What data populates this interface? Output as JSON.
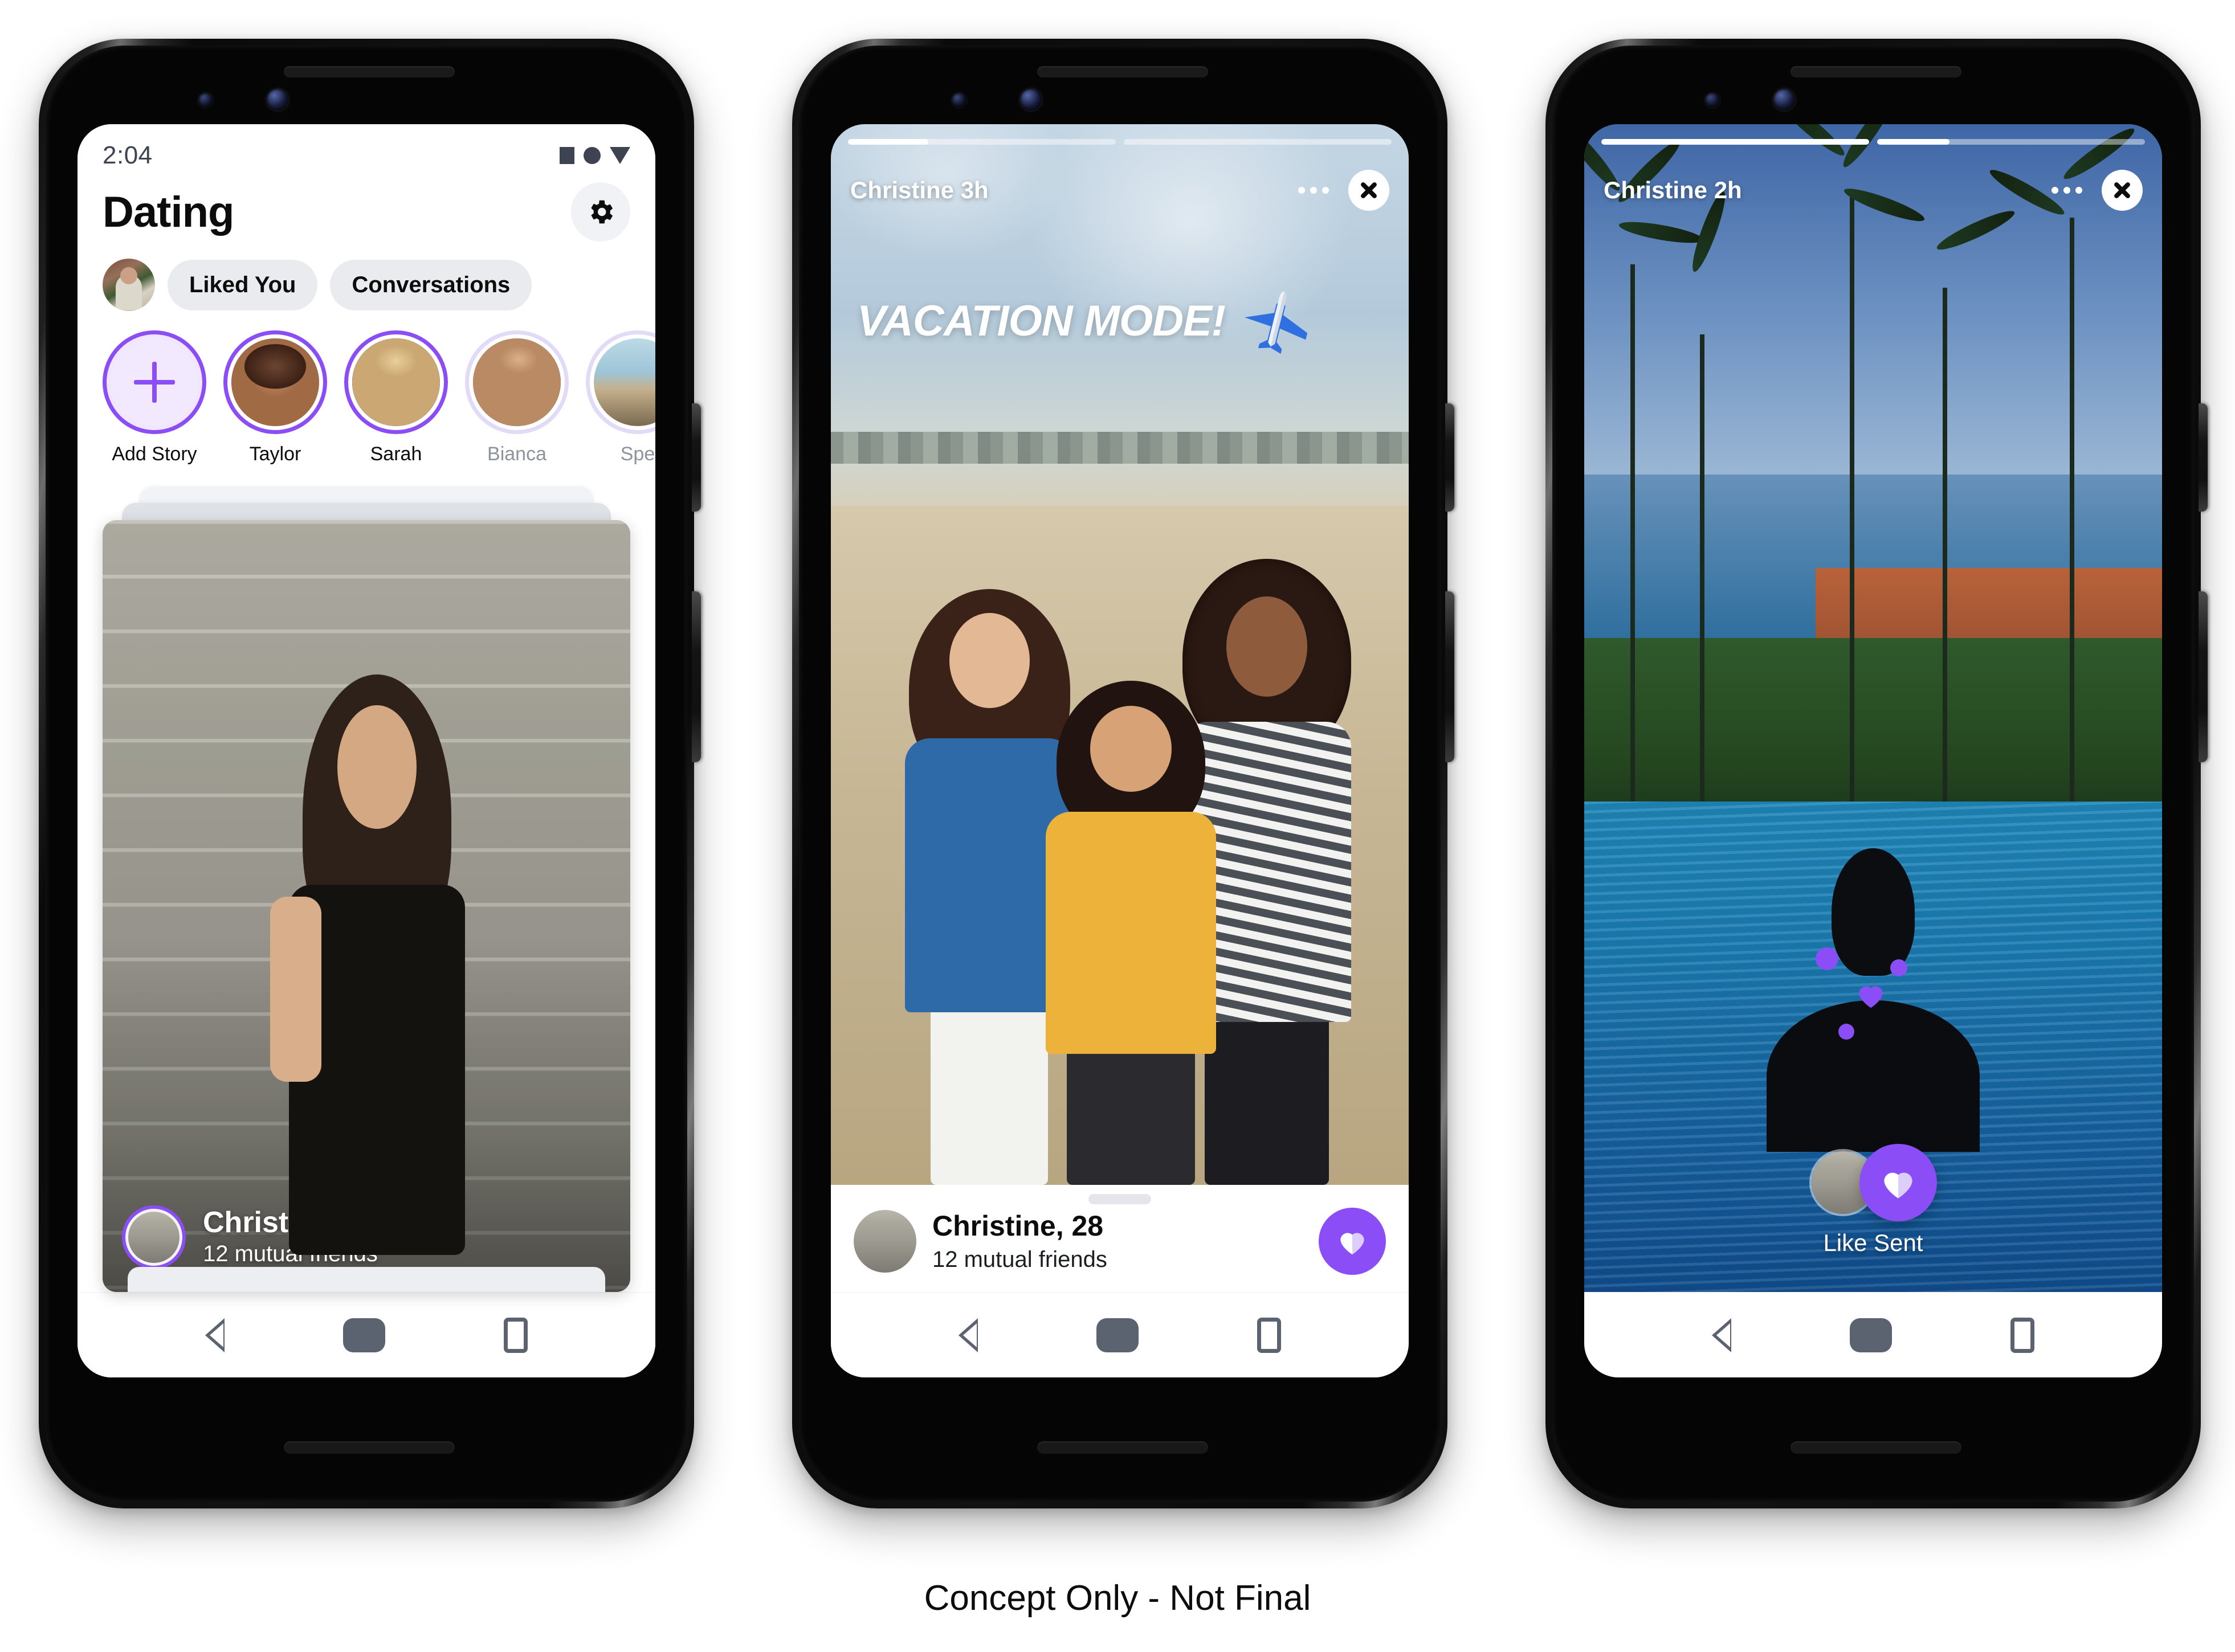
{
  "caption": "Concept Only - Not Final",
  "colors": {
    "accent_purple": "#8B4DF5",
    "pill_bg": "#E9EBEE",
    "status_icon": "#3D4350",
    "nav_icon": "#5B6270",
    "seen_ring": "#E2DBF7"
  },
  "phone1": {
    "status": {
      "time": "2:04",
      "icons": [
        "square-icon",
        "circle-icon",
        "triangle-down-icon"
      ]
    },
    "header": {
      "title": "Dating",
      "settings_icon": "gear-icon"
    },
    "pills": {
      "avatar": "me-avatar",
      "items": [
        "Liked You",
        "Conversations"
      ]
    },
    "stories": [
      {
        "label": "Add Story",
        "state": "add",
        "icon": "plus-icon"
      },
      {
        "label": "Taylor",
        "state": "unseen"
      },
      {
        "label": "Sarah",
        "state": "unseen"
      },
      {
        "label": "Bianca",
        "state": "seen"
      },
      {
        "label": "Spe",
        "state": "seen"
      }
    ],
    "card": {
      "name": "Christine, 28",
      "mutual": "12 mutual friends",
      "avatar": "christine-avatar"
    },
    "nav": [
      "back-icon",
      "home-icon",
      "recents-icon"
    ]
  },
  "phone2": {
    "story": {
      "user": "Christine 3h",
      "menu_icon": "more-options-icon",
      "close_icon": "close-icon",
      "progress": [
        30,
        0
      ],
      "overlay_text": "VACATION MODE!",
      "overlay_emoji": "airplane-icon"
    },
    "sheet": {
      "name": "Christine, 28",
      "mutual": "12 mutual friends",
      "like_icon": "heart-icon",
      "avatar": "christine-avatar"
    },
    "nav": [
      "back-icon",
      "home-icon",
      "recents-icon"
    ]
  },
  "phone3": {
    "story": {
      "user": "Christine 2h",
      "menu_icon": "more-options-icon",
      "close_icon": "close-icon",
      "progress": [
        100,
        27
      ]
    },
    "like_sent": {
      "label": "Like Sent",
      "like_icon": "heart-icon",
      "avatar": "christine-avatar"
    },
    "nav": [
      "back-icon",
      "home-icon",
      "recents-icon"
    ]
  }
}
